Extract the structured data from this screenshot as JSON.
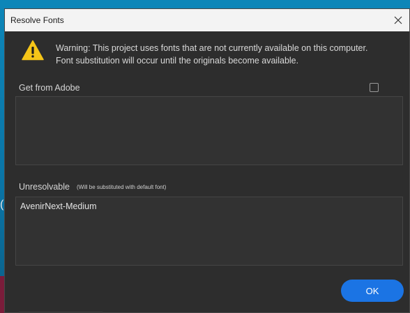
{
  "dialog": {
    "title": "Resolve Fonts",
    "close_icon": "close-icon"
  },
  "warning": {
    "icon": "warning-triangle-icon",
    "line1": "Warning: This project uses fonts that are not currently available on this computer.",
    "line2": "Font substitution will occur until the originals become available."
  },
  "get_from_adobe": {
    "label": "Get from Adobe",
    "checked": false,
    "items": []
  },
  "unresolvable": {
    "label": "Unresolvable",
    "note": "(Will be substituted with default font)",
    "items": [
      "AvenirNext-Medium"
    ]
  },
  "buttons": {
    "ok": "OK"
  },
  "colors": {
    "accent": "#1b74e4",
    "warning": "#f5c518",
    "dialog_bg": "#2d2d2d"
  }
}
